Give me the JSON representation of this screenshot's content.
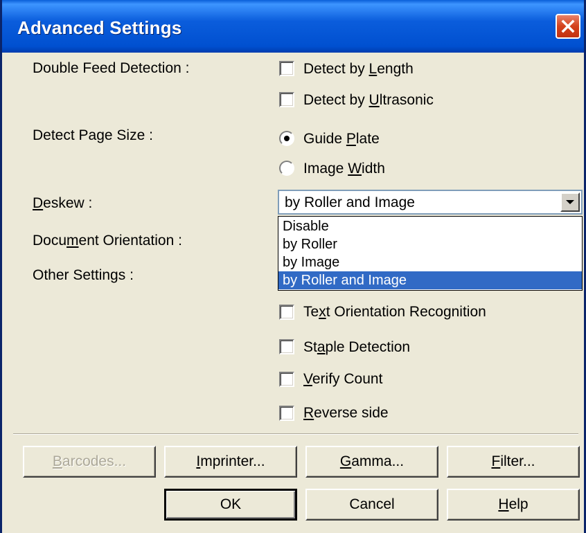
{
  "window": {
    "title": "Advanced Settings"
  },
  "double_feed": {
    "label": "Double Feed Detection :",
    "detect_by_length": {
      "pre": "Detect by ",
      "key": "L",
      "post": "ength",
      "checked": false
    },
    "detect_by_ultrasonic": {
      "pre": "Detect by ",
      "key": "U",
      "post": "ltrasonic",
      "checked": false
    }
  },
  "page_size": {
    "label": "Detect Page Size :",
    "guide_plate": {
      "pre": "Guide ",
      "key": "P",
      "post": "late",
      "selected": true
    },
    "image_width": {
      "pre": "Image ",
      "key": "W",
      "post": "idth",
      "selected": false
    }
  },
  "deskew": {
    "label_key": "D",
    "label_rest": "eskew :",
    "selected": "by Roller and Image",
    "options": [
      "Disable",
      "by Roller",
      "by Image",
      "by Roller and Image"
    ]
  },
  "document_orientation": {
    "pre": "Docu",
    "key": "m",
    "post": "ent Orientation :"
  },
  "other_settings": {
    "label": "Other Settings :"
  },
  "checks": {
    "text_orientation": {
      "pre": "Te",
      "key": "x",
      "post": "t Orientation Recognition",
      "checked": false
    },
    "staple_detection": {
      "pre": "St",
      "key": "a",
      "post": "ple Detection",
      "checked": false
    },
    "verify_count": {
      "pre": "",
      "key": "V",
      "post": "erify Count",
      "checked": false
    },
    "reverse_side": {
      "pre": "",
      "key": "R",
      "post": "everse side",
      "checked": false
    }
  },
  "buttons": {
    "barcodes": {
      "pre": "",
      "key": "B",
      "post": "arcodes...",
      "enabled": false
    },
    "imprinter": {
      "pre": "",
      "key": "I",
      "post": "mprinter..."
    },
    "gamma": {
      "pre": "",
      "key": "G",
      "post": "amma..."
    },
    "filter": {
      "pre": "",
      "key": "F",
      "post": "ilter..."
    },
    "ok": {
      "label": "OK"
    },
    "cancel": {
      "label": "Cancel"
    },
    "help": {
      "pre": "",
      "key": "H",
      "post": "elp"
    }
  },
  "colors": {
    "titlebar": "#0054e3",
    "face": "#ece9d8",
    "highlight": "#316ac5",
    "close": "#d4421c"
  }
}
